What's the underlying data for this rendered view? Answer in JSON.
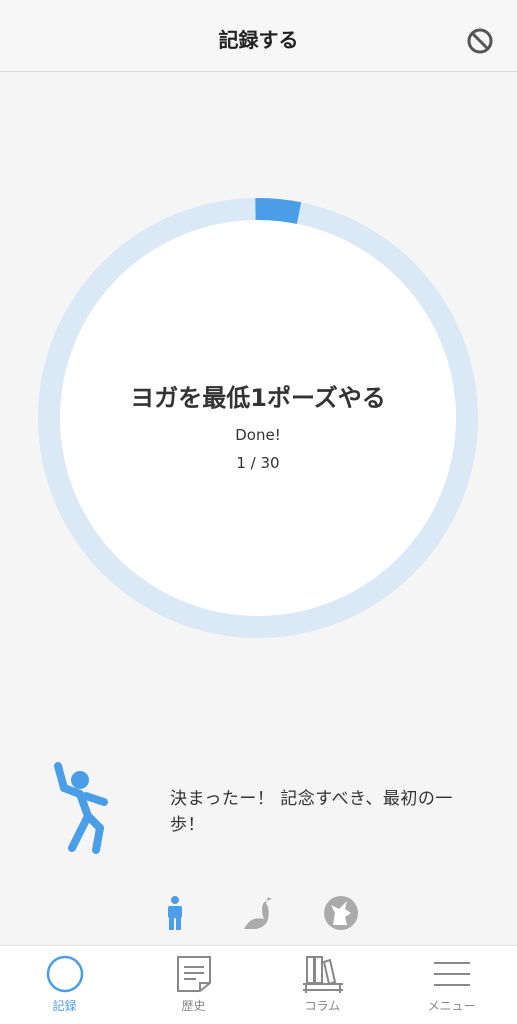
{
  "header": {
    "title": "記録する",
    "action_icon": "prohibit-icon"
  },
  "progress": {
    "goal": "ヨガを最低1ポーズやる",
    "status": "Done!",
    "count_text": "1 / 30",
    "current": 1,
    "total": 30,
    "ring_color": "#4a9ee8",
    "track_color": "#dbe8f5"
  },
  "message": {
    "text": "決まったー！ 記念すべき、最初の一歩！"
  },
  "stages": [
    {
      "icon": "human-figure-icon",
      "active": true
    },
    {
      "icon": "bird-icon",
      "active": false
    },
    {
      "icon": "wolf-icon",
      "active": false
    }
  ],
  "tabs": [
    {
      "label": "記録",
      "icon": "circle-icon",
      "active": true
    },
    {
      "label": "歴史",
      "icon": "document-icon",
      "active": false
    },
    {
      "label": "コラム",
      "icon": "bookshelf-icon",
      "active": false
    },
    {
      "label": "メニュー",
      "icon": "menu-icon",
      "active": false
    }
  ],
  "colors": {
    "accent": "#4a9ee8",
    "inactive": "#888888"
  }
}
